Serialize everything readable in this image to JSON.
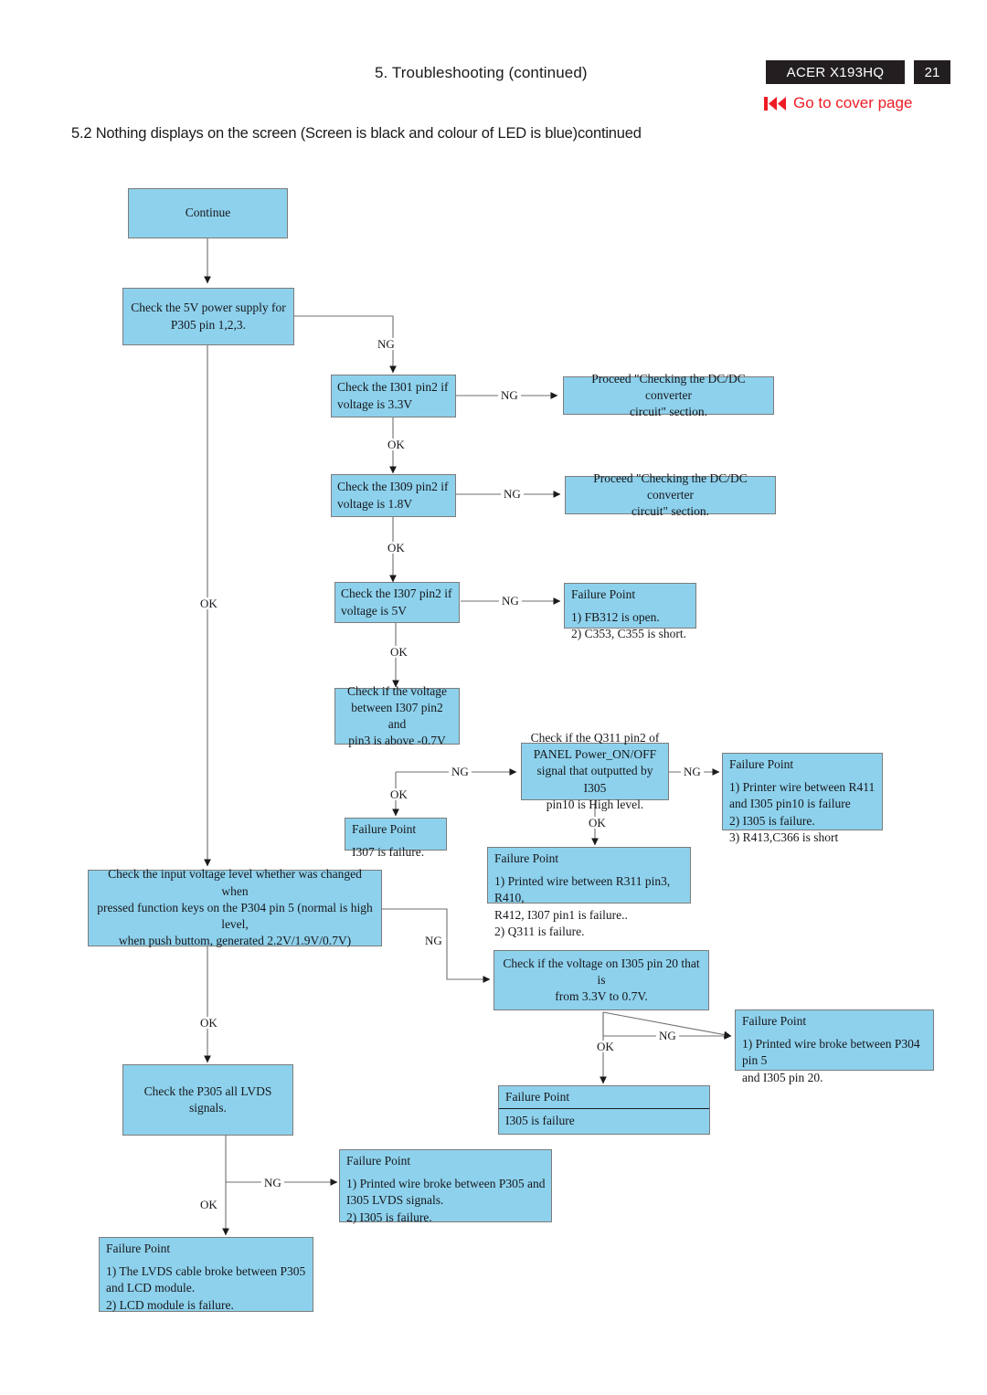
{
  "header": {
    "chapter_title": "5. Troubleshooting (continued)",
    "model_badge": "ACER X193HQ",
    "page_number": "21",
    "cover_link_label": "Go to cover page",
    "cover_link_icon": "skip-to-start-icon",
    "link_color": "#ee1c25",
    "badge_color": "#231f20"
  },
  "section": {
    "title": "5.2  Nothing displays on the screen (Screen is black and colour of LED is blue)continued"
  },
  "flowchart": {
    "node_fill": "#8ED1EC",
    "node_border": "#7c7c7c",
    "nodes": {
      "continue": "Continue",
      "check_5v": "Check the 5V power supply for\nP305 pin 1,2,3.",
      "check_i301": "Check the I301 pin2 if\nvoltage is 3.3V",
      "proceed_dcdc_1": "Proceed \"Checking the DC/DC converter\ncircuit\" section.",
      "check_i309": "Check the I309 pin2 if\nvoltage is 1.8V",
      "proceed_dcdc_2": "Proceed \"Checking the DC/DC converter\ncircuit\" section.",
      "check_i307": "Check the I307 pin2 if\nvoltage is 5V",
      "check_i307_diff": "Check if the voltage\nbetween I307 pin2 and\npin3 is above -0.7V",
      "check_q311": "Check if the Q311 pin2 of\nPANEL Power_ON/OFF\nsignal that outputted by I305\npin10 is High level.",
      "check_input_voltage": "Check the input voltage level whether was changed when\npressed function keys on the P304 pin 5 (normal is high level,\nwhen push buttom, generated 2.2V/1.9V/0.7V)",
      "check_i305_pin20": "Check if the voltage on I305 pin 20 that is\nfrom 3.3V to 0.7V.",
      "check_lvds": "Check the P305 all LVDS signals."
    },
    "failure_points": {
      "heading": "Failure Point",
      "fb312": "1) FB312 is open.\n2) C353, C355 is short.",
      "i307": "I307 is failure.",
      "r411": "1) Printer wire between R411\n    and I305 pin10 is failure\n2) I305 is failure.\n3) R413,C366 is short",
      "r311": "1) Printed wire between R311 pin3, R410,\n    R412, I307 pin1 is failure..\n2) Q311 is failure.",
      "p304_p20": "1) Printed wire broke between P304 pin 5\nand I305 pin 20.",
      "i305": "I305 is failure",
      "p305_lvds": "1) Printed wire broke between P305 and\n    I305 LVDS signals.\n2) I305  is failure.",
      "lvds_cable": "1) The LVDS cable broke between P305\n    and LCD module.\n2) LCD module is failure."
    },
    "edge_labels": {
      "ng": "NG",
      "ok": "OK"
    }
  }
}
